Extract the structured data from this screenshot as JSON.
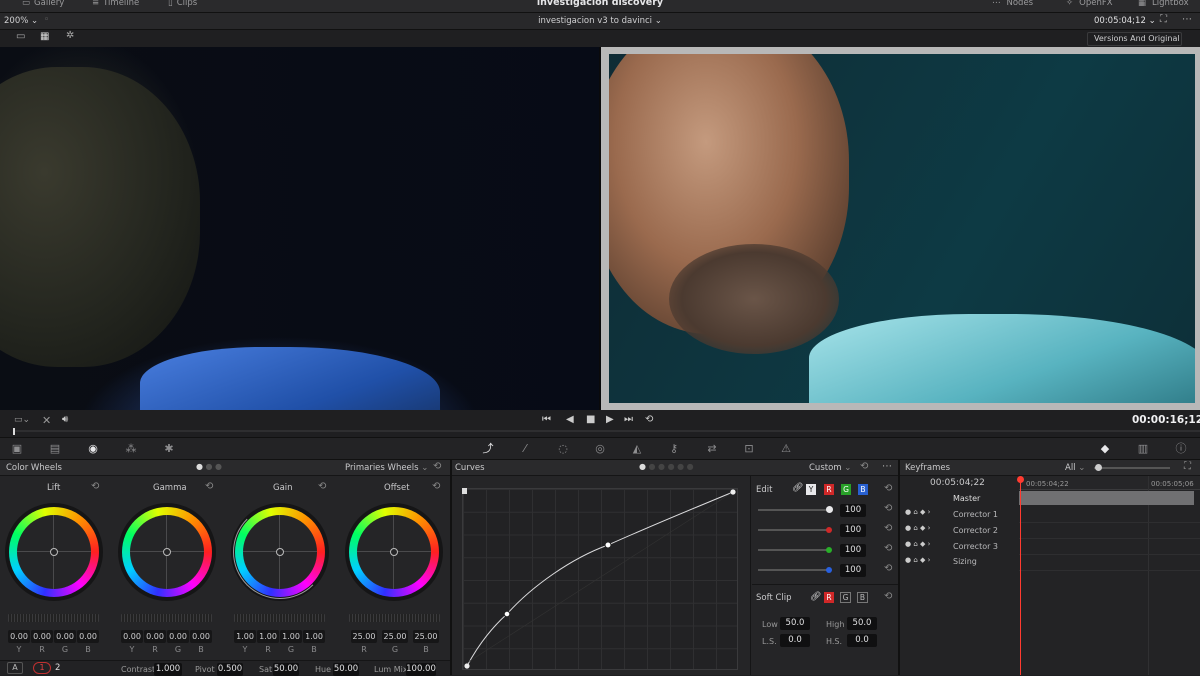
{
  "topbar": {
    "gallery": "Gallery",
    "timeline": "Timeline",
    "clips": "Clips",
    "project_title": "investigacion discovery",
    "nodes": "Nodes",
    "openfx": "OpenFX",
    "lightbox": "Lightbox"
  },
  "viewer_bar": {
    "zoom": "200%",
    "timeline_name": "investigacion v3 to davinci",
    "timecode": "00:05:04;12",
    "view_mode": "Versions And Original"
  },
  "transport": {
    "timecode": "00:00:16;12"
  },
  "color_wheels": {
    "title": "Color Wheels",
    "mode": "Primaries Wheels",
    "wheels": [
      {
        "name": "Lift",
        "values": [
          "0.00",
          "0.00",
          "0.00",
          "0.00"
        ]
      },
      {
        "name": "Gamma",
        "values": [
          "0.00",
          "0.00",
          "0.00",
          "0.00"
        ]
      },
      {
        "name": "Gain",
        "values": [
          "1.00",
          "1.00",
          "1.00",
          "1.00"
        ]
      },
      {
        "name": "Offset",
        "values": [
          "25.00",
          "25.00",
          "25.00"
        ]
      }
    ],
    "ch4": [
      "Y",
      "R",
      "G",
      "B"
    ],
    "ch3": [
      "R",
      "G",
      "B"
    ],
    "footer": {
      "a": "A",
      "p1": "1",
      "p2": "2",
      "contrast_label": "Contrast",
      "contrast": "1.000",
      "pivot_label": "Pivot",
      "pivot": "0.500",
      "sat_label": "Sat",
      "sat": "50.00",
      "hue_label": "Hue",
      "hue": "50.00",
      "lummix_label": "Lum Mix",
      "lummix": "100.00"
    }
  },
  "curves": {
    "title": "Curves",
    "mode": "Custom",
    "edit": "Edit",
    "y": "Y",
    "r": "R",
    "g": "G",
    "b": "B",
    "intensities": [
      "100",
      "100",
      "100",
      "100"
    ],
    "softclip": {
      "title": "Soft Clip",
      "low_label": "Low",
      "low": "50.0",
      "high_label": "High",
      "high": "50.0",
      "ls_label": "L.S.",
      "ls": "0.0",
      "hs_label": "H.S.",
      "hs": "0.0"
    }
  },
  "keyframes": {
    "title": "Keyframes",
    "filter": "All",
    "current_tc": "00:05:04;22",
    "ruler_tc1": "00:05:04;22",
    "ruler_tc2": "00:05:05;06",
    "tracks": [
      "Master",
      "Corrector 1",
      "Corrector 2",
      "Corrector 3",
      "Sizing"
    ]
  },
  "colors": {
    "bg": "#1f1f21",
    "panel": "#252527",
    "accent": "#e03030",
    "playhead": "#ff3b30"
  }
}
